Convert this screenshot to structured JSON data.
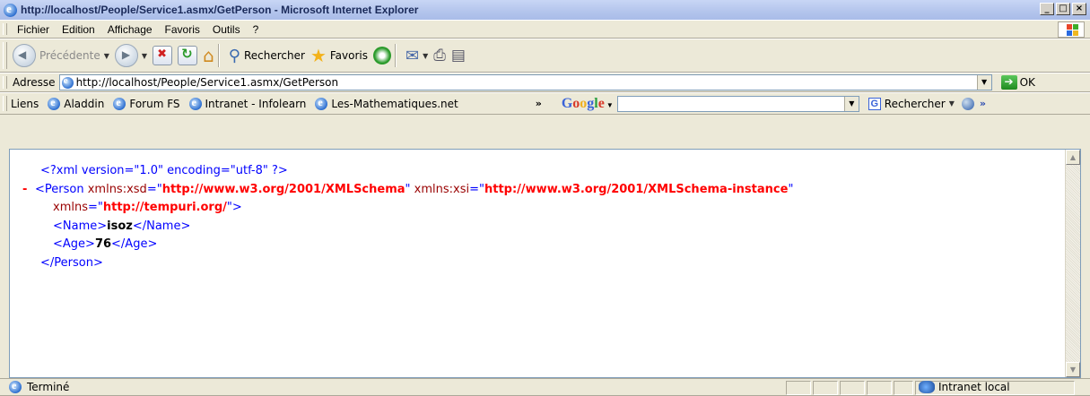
{
  "window": {
    "title": "http://localhost/People/Service1.asmx/GetPerson - Microsoft Internet Explorer",
    "controls": [
      "_",
      "□",
      "×"
    ]
  },
  "menu": {
    "items": [
      {
        "label": "Fichier"
      },
      {
        "label": "Edition"
      },
      {
        "label": "Affichage"
      },
      {
        "label": "Favoris"
      },
      {
        "label": "Outils"
      },
      {
        "label": "?"
      }
    ]
  },
  "toolbar": {
    "back_label": "Précédente",
    "search_label": "Rechercher",
    "favorites_label": "Favoris"
  },
  "address": {
    "label": "Adresse",
    "url": "http://localhost/People/Service1.asmx/GetPerson",
    "go_label": "OK"
  },
  "links": {
    "label": "Liens",
    "items": [
      {
        "label": "Aladdin"
      },
      {
        "label": "Forum FS"
      },
      {
        "label": "Intranet - Infolearn"
      },
      {
        "label": "Les-Mathematiques.net"
      }
    ],
    "chevron": "»"
  },
  "google": {
    "logo_letters": [
      "G",
      "o",
      "o",
      "g",
      "l",
      "e"
    ],
    "search_value": "",
    "search_button_label": "Rechercher",
    "chevron": "»"
  },
  "xml": {
    "declaration": "<?xml version=\"1.0\" encoding=\"utf-8\" ?>",
    "collapse_marker": "-",
    "person_open": "<Person",
    "attr1_name": "xmlns:xsd",
    "attr1_value": "http://www.w3.org/2001/XMLSchema",
    "attr2_name": "xmlns:xsi",
    "attr2_value": "http://www.w3.org/2001/XMLSchema-instance",
    "attr3_name": "xmlns",
    "attr3_value": "http://tempuri.org/",
    "name_open": "<Name>",
    "name_value": "isoz",
    "name_close": "</Name>",
    "age_open": "<Age>",
    "age_value": "76",
    "age_close": "</Age>",
    "person_close": "</Person>"
  },
  "status": {
    "text": "Terminé",
    "zone": "Intranet local"
  },
  "colors": {
    "xml_tag": "#0000ff",
    "xml_attr_value": "#ff0000",
    "xml_attr_name": "#990000"
  }
}
